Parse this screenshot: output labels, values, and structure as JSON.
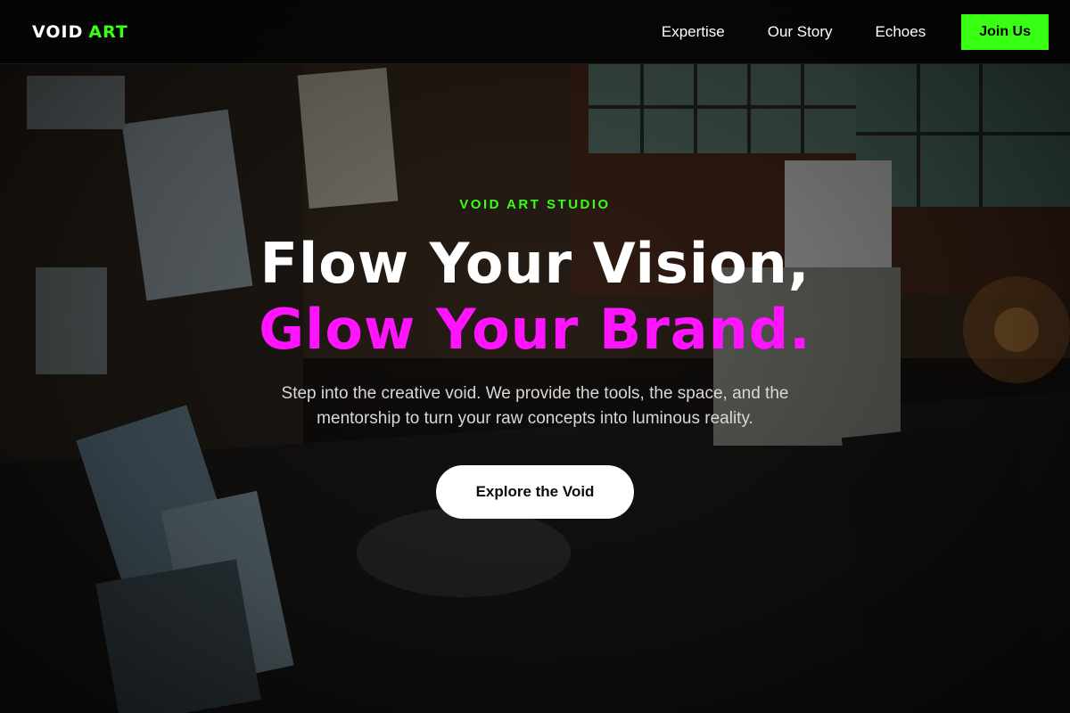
{
  "nav": {
    "logo_word_1": "VOID",
    "logo_word_2": "ART",
    "links": [
      {
        "label": "Expertise"
      },
      {
        "label": "Our Story"
      },
      {
        "label": "Echoes"
      }
    ],
    "cta_label": "Join Us"
  },
  "hero": {
    "eyebrow": "VOID ART STUDIO",
    "headline_line_1": "Flow Your Vision,",
    "headline_line_2": "Glow Your Brand.",
    "subtext": "Step into the creative void. We provide the tools, the space, and the mentorship to turn your raw concepts into luminous reality.",
    "cta_label": "Explore the Void"
  },
  "colors": {
    "accent_green": "#39ff14",
    "accent_magenta": "#ff14ff",
    "nav_background": "#050505",
    "cta_background": "#ffffff"
  },
  "background": {
    "icon": "art-studio-photo"
  }
}
